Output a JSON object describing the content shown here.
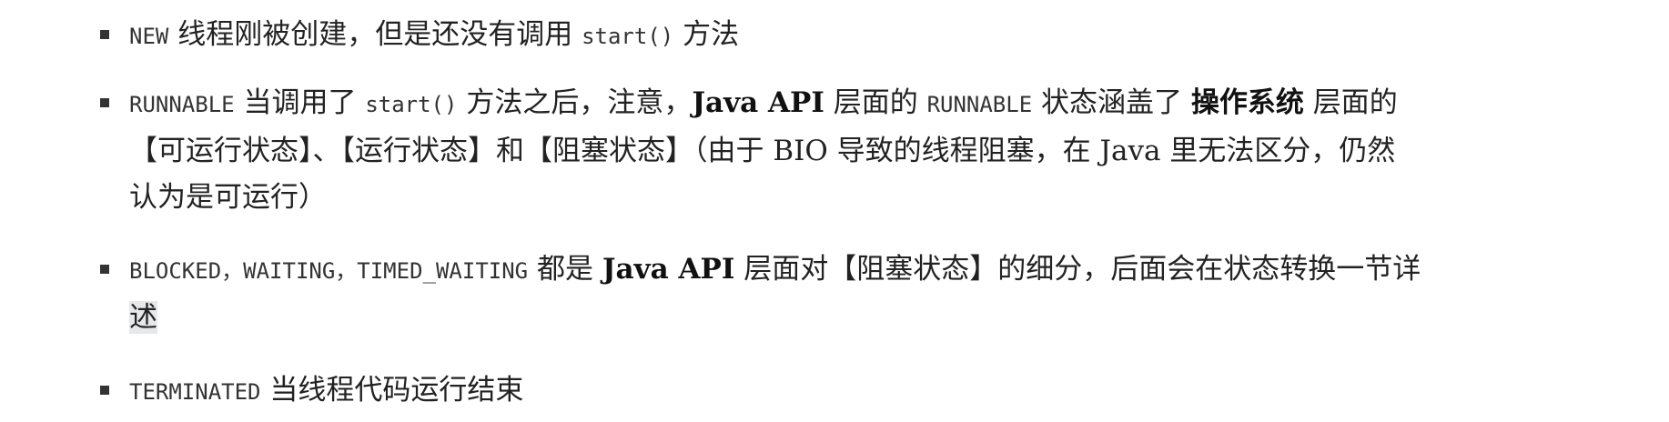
{
  "items": [
    {
      "code": "NEW",
      "text": " 线程刚被创建，但是还没有调用 ",
      "code2": "start()",
      "text2": " 方法"
    },
    {
      "code": "RUNNABLE",
      "text": " 当调用了 ",
      "code2": "start()",
      "text2": " 方法之后，注意，",
      "bold": "Java API",
      "text3": " 层面的 ",
      "code3": "RUNNABLE",
      "text4": " 状态涵盖了 ",
      "bold2": "操作系统",
      "text5": " 层面的",
      "line2": "【可运行状态】、【运行状态】和【阻塞状态】（由于 ",
      "serif1": "BIO",
      "line2b": " 导致的线程阻塞，在 ",
      "serif2": "Java",
      "line2c": " 里无法区分，仍然",
      "line3": "认为是可运行）"
    },
    {
      "code": "BLOCKED，WAITING，TIMED_WAITING",
      "text": " 都是 ",
      "bold": "Java API",
      "text2": " 层面对【阻塞状态】的细分，后面会在状态转换一节详",
      "line2": "述"
    },
    {
      "code": "TERMINATED",
      "text": " 当线程代码运行结束"
    }
  ]
}
